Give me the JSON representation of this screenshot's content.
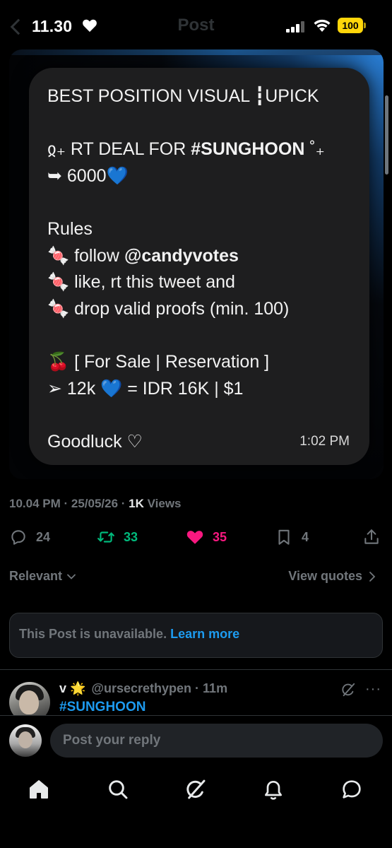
{
  "status_bar": {
    "time": "11.30",
    "battery": "100"
  },
  "header": {
    "title": "Post"
  },
  "media": {
    "lines": [
      "BEST POSITION VISUAL ┇UPICK",
      "",
      "",
      "➥ 6000💙",
      "",
      "Rules",
      "",
      "🍬 like, rt this tweet and",
      "🍬 drop valid proofs (min. 100)",
      "",
      "🍒 [ For Sale | Reservation ]",
      "➢ 12k 💙 = IDR 16K | $1",
      "",
      "Goodluck ♡"
    ],
    "deal_prefix": "ჲ₊ RT DEAL FOR ",
    "deal_tag": "#SUNGHOON",
    "deal_suffix": " ˚₊",
    "follow_prefix": "🍬 follow ",
    "follow_handle": "@candyvotes",
    "time": "1:02 PM"
  },
  "meta": {
    "time_date": "10.04 PM · 25/05/26 · ",
    "views_count": "1K",
    "views_label": " Views"
  },
  "actions": {
    "replies": "24",
    "reposts": "33",
    "likes": "35",
    "bookmarks": "4"
  },
  "sort": {
    "label": "Relevant",
    "view_quotes": "View quotes"
  },
  "unavailable": {
    "text": "This Post is unavailable. ",
    "link": "Learn more"
  },
  "reply": {
    "name": "v 🌟",
    "handle": "@ursecrethypen · 11m",
    "body": "#SUNGHOON"
  },
  "composer": {
    "placeholder": "Post your reply"
  },
  "colors": {
    "accent": "#1d9bf0",
    "repost": "#00ba7c",
    "like": "#f91880",
    "muted": "#71767b"
  }
}
